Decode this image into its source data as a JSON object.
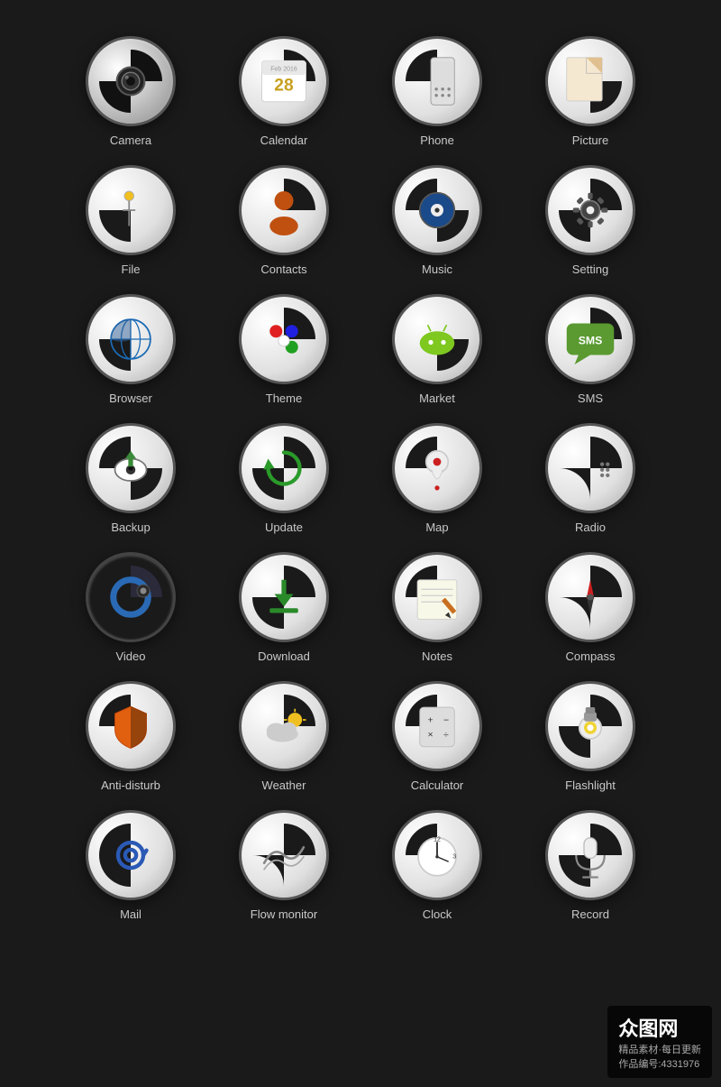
{
  "icons": [
    {
      "id": "camera",
      "label": "Camera",
      "row": 1
    },
    {
      "id": "calendar",
      "label": "Calendar",
      "row": 1
    },
    {
      "id": "phone",
      "label": "Phone",
      "row": 1
    },
    {
      "id": "picture",
      "label": "Picture",
      "row": 1
    },
    {
      "id": "file",
      "label": "File",
      "row": 2
    },
    {
      "id": "contacts",
      "label": "Contacts",
      "row": 2
    },
    {
      "id": "music",
      "label": "Music",
      "row": 2
    },
    {
      "id": "setting",
      "label": "Setting",
      "row": 2
    },
    {
      "id": "browser",
      "label": "Browser",
      "row": 3
    },
    {
      "id": "theme",
      "label": "Theme",
      "row": 3
    },
    {
      "id": "market",
      "label": "Market",
      "row": 3
    },
    {
      "id": "sms",
      "label": "SMS",
      "row": 3
    },
    {
      "id": "backup",
      "label": "Backup",
      "row": 4
    },
    {
      "id": "update",
      "label": "Update",
      "row": 4
    },
    {
      "id": "map",
      "label": "Map",
      "row": 4
    },
    {
      "id": "radio",
      "label": "Radio",
      "row": 4
    },
    {
      "id": "video",
      "label": "Video",
      "row": 5
    },
    {
      "id": "download",
      "label": "Download",
      "row": 5
    },
    {
      "id": "notes",
      "label": "Notes",
      "row": 5
    },
    {
      "id": "compass",
      "label": "Compass",
      "row": 5
    },
    {
      "id": "antidisturb",
      "label": "Anti-disturb",
      "row": 6
    },
    {
      "id": "weather",
      "label": "Weather",
      "row": 6
    },
    {
      "id": "calculator",
      "label": "Calculator",
      "row": 6
    },
    {
      "id": "flashlight",
      "label": "Flashlight",
      "row": 6
    },
    {
      "id": "mail",
      "label": "Mail",
      "row": 7
    },
    {
      "id": "flowmonitor",
      "label": "Flow monitor",
      "row": 7
    },
    {
      "id": "clock",
      "label": "Clock",
      "row": 7
    },
    {
      "id": "record",
      "label": "Record",
      "row": 7
    }
  ],
  "watermark": {
    "site": "众图网",
    "tagline": "精品素材·每日更新",
    "code": "作品编号:4331976"
  }
}
